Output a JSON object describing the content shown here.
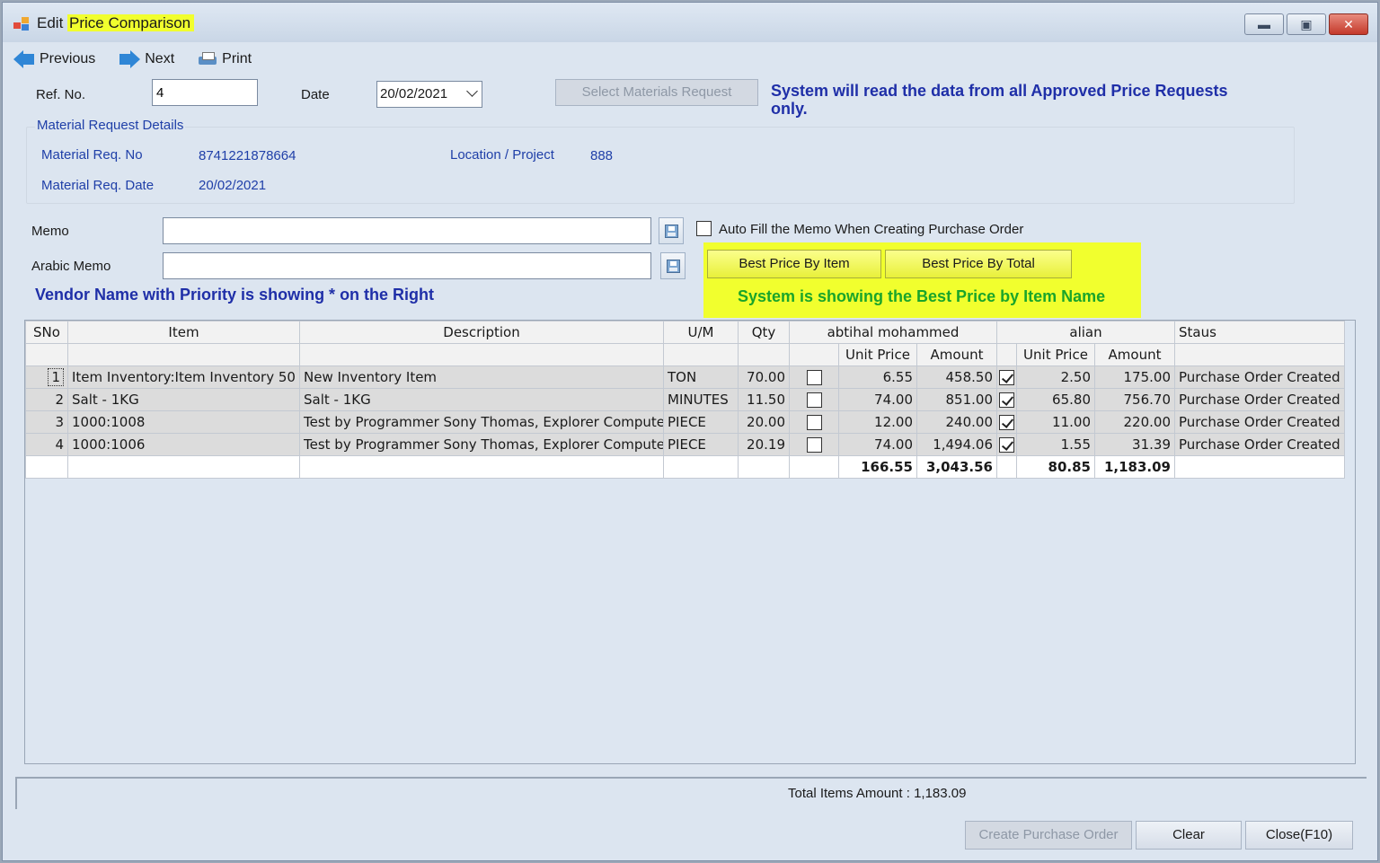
{
  "window": {
    "title_prefix": "Edit",
    "title_highlight": "Price Comparison"
  },
  "toolbar": {
    "previous": "Previous",
    "next": "Next",
    "print": "Print"
  },
  "form": {
    "ref_label": "Ref. No.",
    "ref_value": "4",
    "date_label": "Date",
    "date_value": "20/02/2021",
    "select_button": "Select Materials Request",
    "notice": "System will read the data from all Approved Price Requests only."
  },
  "material_request": {
    "group_title": "Material Request Details",
    "req_no_label": "Material Req. No",
    "req_no_value": "8741221878664",
    "location_label": "Location / Project",
    "location_value": "888",
    "req_date_label": "Material Req. Date",
    "req_date_value": "20/02/2021"
  },
  "memo": {
    "memo_label": "Memo",
    "memo_value": "",
    "arabic_label": "Arabic Memo",
    "arabic_value": "",
    "autofill_label": "Auto Fill the Memo When Creating Purchase Order",
    "autofill_checked": false
  },
  "best_price": {
    "by_item": "Best Price By Item",
    "by_total": "Best Price By Total",
    "note": "System is showing the Best Price by Item Name",
    "highlight_color": "#f1ff2e"
  },
  "vendor_note": "Vendor Name with Priority is showing * on the Right",
  "grid": {
    "headers": {
      "sno": "SNo",
      "item": "Item",
      "description": "Description",
      "um": "U/M",
      "qty": "Qty",
      "vendor1": "abtihal mohammed",
      "vendor2": "alian",
      "status": "Staus",
      "unit_price": "Unit Price",
      "amount": "Amount"
    },
    "rows": [
      {
        "sno": "1",
        "item": "Item Inventory:Item Inventory 50",
        "description": "New Inventory Item",
        "um": "TON",
        "qty": "70.00",
        "v1_selected": false,
        "v1_unit": "6.55",
        "v1_amount": "458.50",
        "v2_selected": true,
        "v2_unit": "2.50",
        "v2_amount": "175.00",
        "status": "Purchase Order Created"
      },
      {
        "sno": "2",
        "item": "Salt - 1KG",
        "description": "Salt - 1KG",
        "um": "MINUTES",
        "qty": "11.50",
        "v1_selected": false,
        "v1_unit": "74.00",
        "v1_amount": "851.00",
        "v2_selected": true,
        "v2_unit": "65.80",
        "v2_amount": "756.70",
        "status": "Purchase Order Created"
      },
      {
        "sno": "3",
        "item": "1000:1008",
        "description": "Test by Programmer Sony Thomas, Explorer Computer",
        "um": "PIECE",
        "qty": "20.00",
        "v1_selected": false,
        "v1_unit": "12.00",
        "v1_amount": "240.00",
        "v2_selected": true,
        "v2_unit": "11.00",
        "v2_amount": "220.00",
        "status": "Purchase Order Created"
      },
      {
        "sno": "4",
        "item": "1000:1006",
        "description": "Test by Programmer Sony Thomas, Explorer Computer",
        "um": "PIECE",
        "qty": "20.19",
        "v1_selected": false,
        "v1_unit": "74.00",
        "v1_amount": "1,494.06",
        "v2_selected": true,
        "v2_unit": "1.55",
        "v2_amount": "31.39",
        "status": "Purchase Order Created"
      }
    ],
    "totals": {
      "v1_unit": "166.55",
      "v1_amount": "3,043.56",
      "v2_unit": "80.85",
      "v2_amount": "1,183.09"
    }
  },
  "status_bar": {
    "total_label": "Total Items Amount :",
    "total_value": "1,183.09"
  },
  "buttons": {
    "create_po": "Create Purchase Order",
    "clear": "Clear",
    "close": "Close(F10)"
  },
  "icons": {
    "app": "app-icon",
    "previous": "arrow-left-icon",
    "next": "arrow-right-icon",
    "print": "printer-icon",
    "save": "save-disk-icon"
  }
}
